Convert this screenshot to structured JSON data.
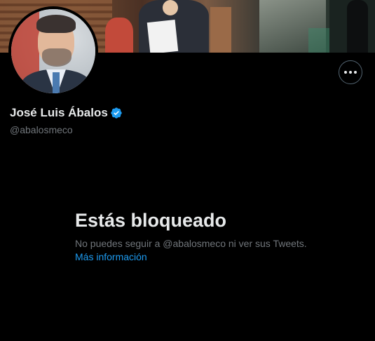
{
  "profile": {
    "display_name": "José Luis Ábalos",
    "handle": "@abalosmeco",
    "verified_icon": "verified-badge-icon",
    "more_icon": "more-options-icon"
  },
  "blocked": {
    "title": "Estás bloqueado",
    "message": "No puedes seguir a @abalosmeco ni ver sus Tweets.",
    "link_label": "Más información"
  },
  "colors": {
    "background": "#000000",
    "text_primary": "#e7e9ea",
    "text_secondary": "#71767b",
    "accent": "#1d9bf0"
  }
}
